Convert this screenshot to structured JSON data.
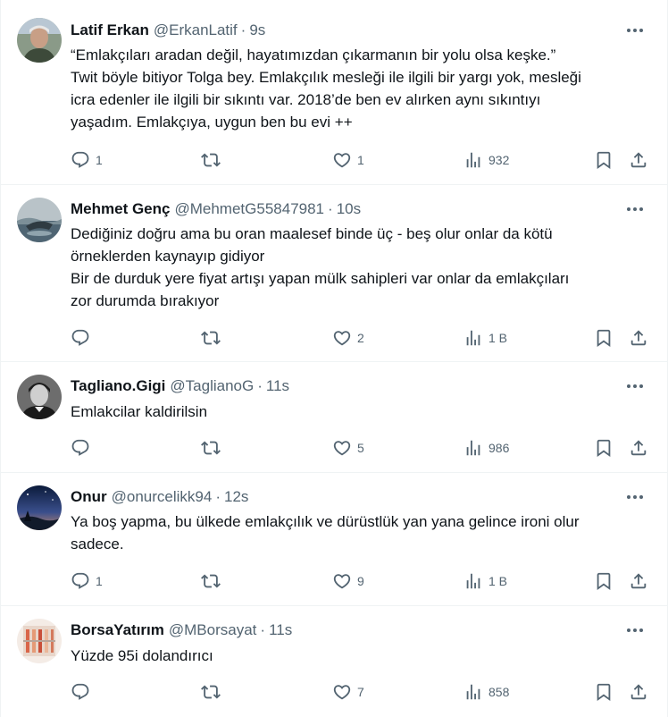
{
  "tweets": [
    {
      "name": "Latif Erkan",
      "handle": "@ErkanLatif",
      "dot": "·",
      "time": "9s",
      "lines": [
        "“Emlakçıları aradan değil, hayatımızdan çıkarmanın bir yolu olsa keşke.”",
        "Twit böyle bitiyor Tolga bey.  Emlakçılık mesleği ile ilgili bir yargı yok, mesleği",
        "icra edenler ile ilgili bir sıkıntı var.  2018’de ben ev alırken aynı sıkıntıyı",
        "yaşadım.  Emlakçıya, uygun ben bu evi ++"
      ],
      "replies": "1",
      "retweets": "",
      "likes": "1",
      "views": "932"
    },
    {
      "name": "Mehmet Genç",
      "handle": "@MehmetG55847981",
      "dot": "·",
      "time": "10s",
      "lines": [
        "Dediğiniz doğru ama bu oran maalesef binde üç - beş olur onlar da kötü",
        "örneklerden kaynayıp gidiyor",
        "Bir de durduk yere fiyat artışı yapan mülk sahipleri var onlar da emlakçıları",
        "zor durumda bırakıyor"
      ],
      "replies": "",
      "retweets": "",
      "likes": "2",
      "views": "1 B"
    },
    {
      "name": "Tagliano.Gigi",
      "handle": "@TaglianoG",
      "dot": "·",
      "time": "11s",
      "lines": [
        "Emlakcilar kaldirilsin"
      ],
      "replies": "",
      "retweets": "",
      "likes": "5",
      "views": "986"
    },
    {
      "name": "Onur",
      "handle": "@onurcelikk94",
      "dot": "·",
      "time": "12s",
      "lines": [
        "Ya boş yapma, bu ülkede emlakçılık ve dürüstlük yan yana gelince ironi olur",
        "sadece."
      ],
      "replies": "1",
      "retweets": "",
      "likes": "9",
      "views": "1 B"
    },
    {
      "name": "BorsaYatırım",
      "handle": "@MBorsayat",
      "dot": "·",
      "time": "11s",
      "lines": [
        "Yüzde 95i dolandırıcı"
      ],
      "replies": "",
      "retweets": "",
      "likes": "7",
      "views": "858"
    }
  ],
  "icons": {
    "reply": "reply-icon",
    "retweet": "retweet-icon",
    "like": "heart-icon",
    "views": "views-icon",
    "bookmark": "bookmark-icon",
    "share": "share-icon",
    "more": "more-icon"
  },
  "colors": {
    "text": "#0f1419",
    "secondary": "#536471",
    "divider": "#eff3f4"
  }
}
